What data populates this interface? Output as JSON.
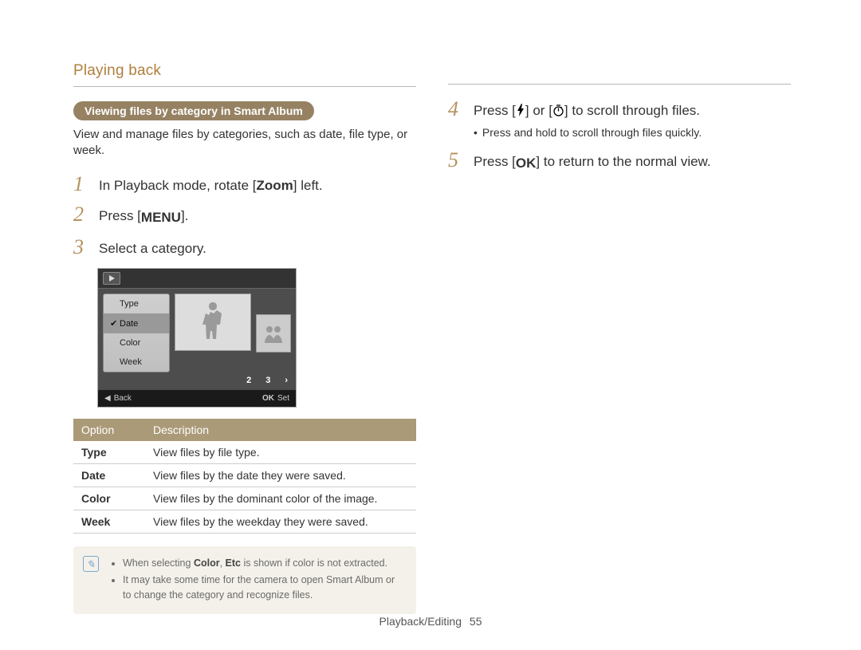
{
  "header": {
    "breadcrumb": "Playing back"
  },
  "section": {
    "pill": "Viewing files by category in Smart Album",
    "desc": "View and manage files by categories, such as date, file type, or week."
  },
  "steps_left": [
    {
      "num": "1",
      "text_pre": "In Playback mode, rotate [",
      "text_bold": "Zoom",
      "text_post": "] left."
    },
    {
      "num": "2",
      "text_pre": "Press [",
      "icon": "MENU",
      "text_post": "]."
    },
    {
      "num": "3",
      "text_pre": "Select a category."
    }
  ],
  "screenshot": {
    "menu": [
      {
        "label": "Type",
        "checked": false,
        "selected": false
      },
      {
        "label": "Date",
        "checked": true,
        "selected": true
      },
      {
        "label": "Color",
        "checked": false,
        "selected": false
      },
      {
        "label": "Week",
        "checked": false,
        "selected": false
      }
    ],
    "pager": [
      "2",
      "3"
    ],
    "footer_left_label": "Back",
    "footer_right_prefix": "OK",
    "footer_right_label": "Set"
  },
  "table": {
    "header": [
      "Option",
      "Description"
    ],
    "rows": [
      [
        "Type",
        "View files by file type."
      ],
      [
        "Date",
        "View files by the date they were saved."
      ],
      [
        "Color",
        "View files by the dominant color of the image."
      ],
      [
        "Week",
        "View files by the weekday they were saved."
      ]
    ]
  },
  "note": {
    "items": [
      {
        "pre": "When selecting ",
        "b1": "Color",
        "mid": ", ",
        "b2": "Etc",
        "post": " is shown if color is not extracted."
      },
      {
        "pre": "It may take some time for the camera to open Smart Album or to change the category and recognize files."
      }
    ]
  },
  "steps_right": [
    {
      "num": "4",
      "parts": [
        {
          "t": "Press ["
        },
        {
          "icon": "flash"
        },
        {
          "t": "] or ["
        },
        {
          "icon": "timer"
        },
        {
          "t": "] to scroll through files."
        }
      ],
      "sub": "Press and hold to scroll through files quickly."
    },
    {
      "num": "5",
      "parts": [
        {
          "t": "Press ["
        },
        {
          "icon": "OK"
        },
        {
          "t": "] to return to the normal view."
        }
      ]
    }
  ],
  "footer": {
    "section": "Playback/Editing",
    "page": "55"
  }
}
